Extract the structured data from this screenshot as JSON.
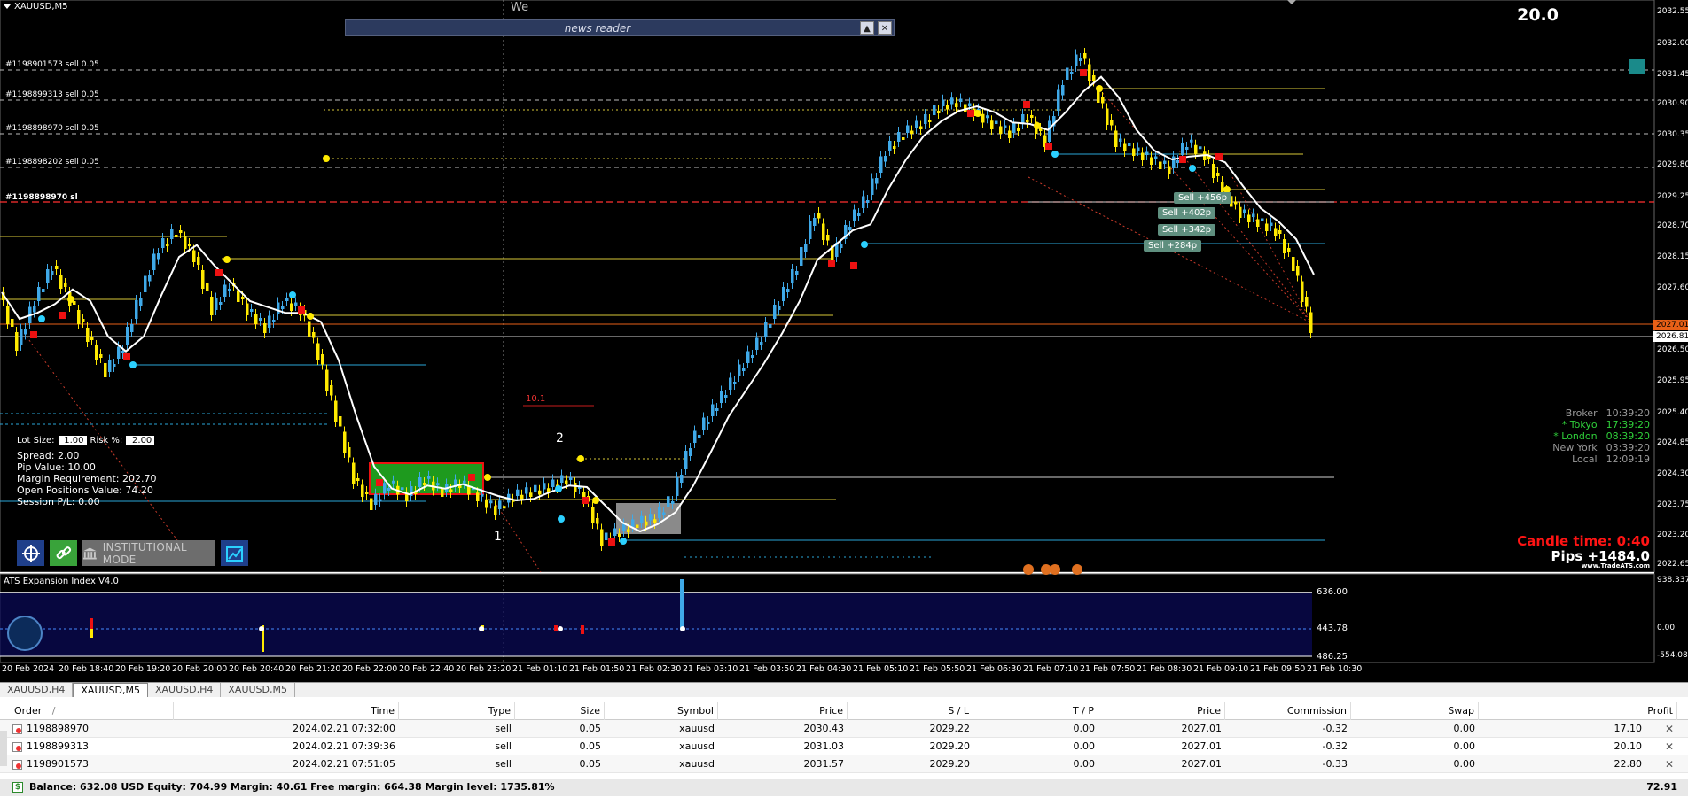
{
  "window": {
    "symbol_title": "XAUUSD,M5",
    "day_label": "We",
    "spread_display": "20.0",
    "news_reader": {
      "title": "news reader",
      "up_icon": "▲",
      "close_icon": "✕"
    }
  },
  "order_lines": [
    "#1198901573 sell 0.05",
    "#1198899313 sell 0.05",
    "#1198898970 sell 0.05",
    "#1198898202 sell 0.05",
    "#1198898970 sl"
  ],
  "info_panel": {
    "lot_size_label": "Lot Size:",
    "lot_size_value": "1.00",
    "risk_label": "Risk %:",
    "risk_value": "2.00",
    "spread": "Spread: 2.00",
    "pip_value": "Pip Value: 10.00",
    "margin_req": "Margin Requirement: 202.70",
    "open_value": "Open Positions Value: 74.20",
    "session_pl": "Session P/L: 0.00"
  },
  "toolbar": {
    "institutional_label": "INSTITUTIONAL MODE"
  },
  "sell_tags": [
    "Sell +456p",
    "Sell +402p",
    "Sell +342p",
    "Sell +284p"
  ],
  "chart_annotations": {
    "fib_label": "10.1",
    "wave_2": "2",
    "wave_1": "1"
  },
  "clocks": [
    {
      "name": "Broker",
      "time": "10:39:20",
      "color": "#9a9a9a"
    },
    {
      "name": "* Tokyo",
      "time": "17:39:20",
      "color": "#2fcf3a"
    },
    {
      "name": "* London",
      "time": "08:39:20",
      "color": "#2fcf3a"
    },
    {
      "name": "New York",
      "time": "03:39:20",
      "color": "#9a9a9a"
    },
    {
      "name": "Local",
      "time": "12:09:19",
      "color": "#9a9a9a"
    }
  ],
  "candle_time": "Candle time:  0:40",
  "pips": "Pips +1484.0",
  "brand": "www.TradeATS.com",
  "price_axis": {
    "labels": [
      "2032.55",
      "2032.00",
      "2031.45",
      "2030.90",
      "2030.35",
      "2029.80",
      "2029.25",
      "2028.70",
      "2028.15",
      "2027.60",
      "2026.50",
      "2025.95",
      "2025.40",
      "2024.85",
      "2024.30",
      "2023.75",
      "2023.20",
      "2022.65"
    ],
    "current_price": "2027.01",
    "bid_price": "2026.81"
  },
  "indicator": {
    "title": "ATS Expansion Index V4.0",
    "level_top": "636.00",
    "level_mid": "443.78",
    "level_low": "486.25",
    "axis_top": "938.337",
    "axis_mid": "0.00",
    "axis_low": "-554.087"
  },
  "time_axis": [
    "20 Feb 2024",
    "20 Feb 18:40",
    "20 Feb 19:20",
    "20 Feb 20:00",
    "20 Feb 20:40",
    "20 Feb 21:20",
    "20 Feb 22:00",
    "20 Feb 22:40",
    "20 Feb 23:20",
    "21 Feb 01:10",
    "21 Feb 01:50",
    "21 Feb 02:30",
    "21 Feb 03:10",
    "21 Feb 03:50",
    "21 Feb 04:30",
    "21 Feb 05:10",
    "21 Feb 05:50",
    "21 Feb 06:30",
    "21 Feb 07:10",
    "21 Feb 07:50",
    "21 Feb 08:30",
    "21 Feb 09:10",
    "21 Feb 09:50",
    "21 Feb 10:30"
  ],
  "tabs": [
    "XAUUSD,H4",
    "XAUUSD,M5",
    "XAUUSD,H4",
    "XAUUSD,M5"
  ],
  "terminal": {
    "headers": {
      "order": "Order",
      "order_sort": "/",
      "time": "Time",
      "type": "Type",
      "size": "Size",
      "symbol": "Symbol",
      "price": "Price",
      "sl": "S / L",
      "tp": "T / P",
      "price2": "Price",
      "commission": "Commission",
      "swap": "Swap",
      "profit": "Profit"
    },
    "rows": [
      {
        "order": "1198898970",
        "time": "2024.02.21 07:32:00",
        "type": "sell",
        "size": "0.05",
        "symbol": "xauusd",
        "price": "2030.43",
        "sl": "2029.22",
        "tp": "0.00",
        "price2": "2027.01",
        "commission": "-0.32",
        "swap": "0.00",
        "profit": "17.10"
      },
      {
        "order": "1198899313",
        "time": "2024.02.21 07:39:36",
        "type": "sell",
        "size": "0.05",
        "symbol": "xauusd",
        "price": "2031.03",
        "sl": "2029.20",
        "tp": "0.00",
        "price2": "2027.01",
        "commission": "-0.32",
        "swap": "0.00",
        "profit": "20.10"
      },
      {
        "order": "1198901573",
        "time": "2024.02.21 07:51:05",
        "type": "sell",
        "size": "0.05",
        "symbol": "xauusd",
        "price": "2031.57",
        "sl": "2029.20",
        "tp": "0.00",
        "price2": "2027.01",
        "commission": "-0.33",
        "swap": "0.00",
        "profit": "22.80"
      }
    ],
    "balance_text": "Balance: 632.08 USD  Equity: 704.99  Margin: 40.61  Free margin: 664.38  Margin level: 1735.81%",
    "total_profit": "72.91",
    "close_icon": "✕"
  },
  "colors": {
    "bull": "#3fa9e8",
    "bear": "#ffea00",
    "ma": "#ffffff",
    "order_line": "#c8c8c8",
    "sl_line": "#ff3030",
    "yellow_level": "#d8c838",
    "blue_level": "#2aa6d8"
  }
}
